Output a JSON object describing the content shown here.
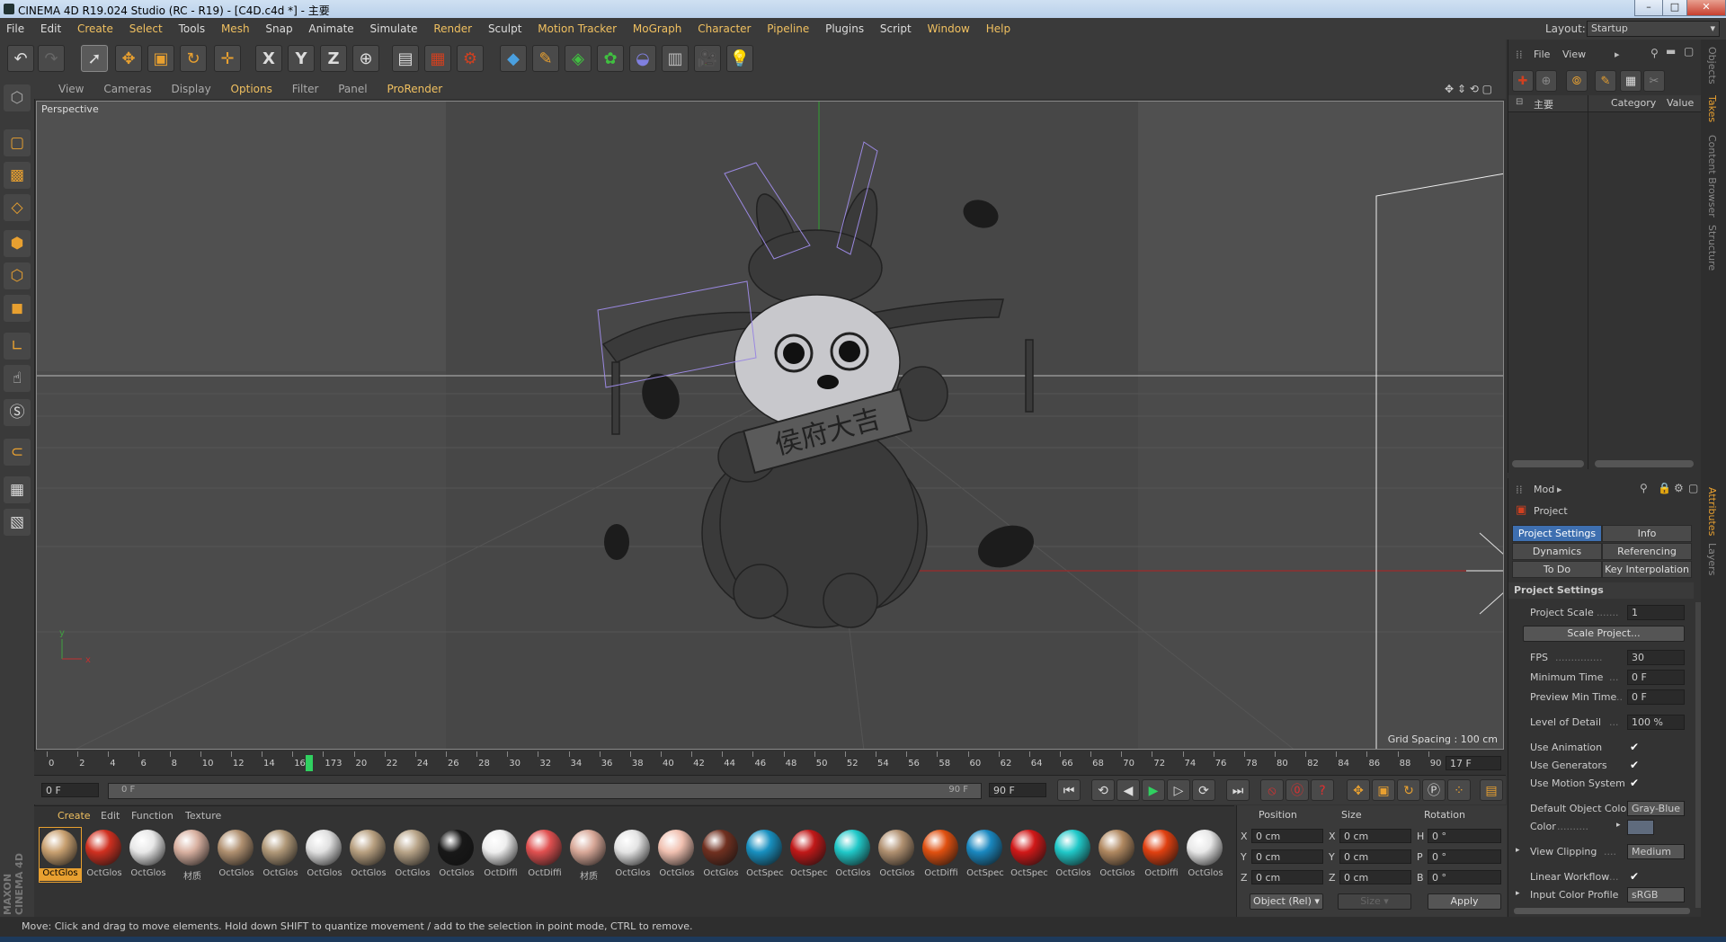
{
  "window": {
    "title": "CINEMA 4D R19.024 Studio (RC - R19) - [C4D.c4d *] - 主要"
  },
  "menubar": {
    "items": [
      "File",
      "Edit",
      "Create",
      "Select",
      "Tools",
      "Mesh",
      "Snap",
      "Animate",
      "Simulate",
      "Render",
      "Sculpt",
      "Motion Tracker",
      "MoGraph",
      "Character",
      "Pipeline",
      "Plugins",
      "Script",
      "Window",
      "Help"
    ]
  },
  "layout": {
    "label": "Layout:",
    "value": "Startup"
  },
  "viewport_menu": {
    "items": [
      "View",
      "Cameras",
      "Display",
      "Options",
      "Filter",
      "Panel",
      "ProRender"
    ]
  },
  "viewport": {
    "name": "Perspective",
    "grid_spacing": "Grid Spacing : 100 cm",
    "axis_y": "y",
    "axis_x": "x",
    "banner_text": "侯府大吉"
  },
  "timeline": {
    "ticks": [
      "0",
      "2",
      "4",
      "6",
      "8",
      "10",
      "12",
      "14",
      "16",
      "173",
      "20",
      "22",
      "24",
      "26",
      "28",
      "30",
      "32",
      "34",
      "36",
      "38",
      "40",
      "42",
      "44",
      "46",
      "48",
      "50",
      "52",
      "54",
      "56",
      "58",
      "60",
      "62",
      "64",
      "66",
      "68",
      "70",
      "72",
      "74",
      "76",
      "78",
      "80",
      "82",
      "84",
      "86",
      "88",
      "90"
    ],
    "current_frame": "17 F",
    "start": "0 F",
    "range_start": "0 F",
    "range_end": "90 F",
    "end": "90 F"
  },
  "material_manager": {
    "menu": [
      "Create",
      "Edit",
      "Function",
      "Texture"
    ],
    "materials": [
      {
        "name": "OctGlos",
        "color": "#c8a070",
        "selected": true
      },
      {
        "name": "OctGlos",
        "color": "#d03020"
      },
      {
        "name": "OctGlos",
        "color": "#e8e8e8"
      },
      {
        "name": "材质",
        "color": "#d8b0a0"
      },
      {
        "name": "OctGlos",
        "color": "#b09070"
      },
      {
        "name": "OctGlos",
        "color": "#b09878"
      },
      {
        "name": "OctGlos",
        "color": "#e0e0e0"
      },
      {
        "name": "OctGlos",
        "color": "#b8a080"
      },
      {
        "name": "OctGlos",
        "color": "#b8a488"
      },
      {
        "name": "OctGlos",
        "color": "#181818"
      },
      {
        "name": "OctDiffi",
        "color": "#eeeeee"
      },
      {
        "name": "OctDiffi",
        "color": "#e05050"
      },
      {
        "name": "材质",
        "color": "#d8a898"
      },
      {
        "name": "OctGlos",
        "color": "#e4e4e4"
      },
      {
        "name": "OctGlos",
        "color": "#f0c0b0"
      },
      {
        "name": "OctGlos",
        "color": "#703020"
      },
      {
        "name": "OctSpec",
        "color": "#1890c0"
      },
      {
        "name": "OctSpec",
        "color": "#c01818"
      },
      {
        "name": "OctGlos",
        "color": "#20c8c8"
      },
      {
        "name": "OctGlos",
        "color": "#b09070"
      },
      {
        "name": "OctDiffi",
        "color": "#e05010"
      },
      {
        "name": "OctSpec",
        "color": "#1a88c0"
      },
      {
        "name": "OctSpec",
        "color": "#d01818"
      },
      {
        "name": "OctGlos",
        "color": "#20c8c8"
      },
      {
        "name": "OctGlos",
        "color": "#b08860"
      },
      {
        "name": "OctDiffi",
        "color": "#e04010"
      },
      {
        "name": "OctGlos",
        "color": "#e8e8e8"
      }
    ]
  },
  "coordinates": {
    "headers": [
      "Position",
      "Size",
      "Rotation"
    ],
    "rows": [
      {
        "axis": "X",
        "pos": "0 cm",
        "size_axis": "X",
        "size": "0 cm",
        "rot_axis": "H",
        "rot": "0 °"
      },
      {
        "axis": "Y",
        "pos": "0 cm",
        "size_axis": "Y",
        "size": "0 cm",
        "rot_axis": "P",
        "rot": "0 °"
      },
      {
        "axis": "Z",
        "pos": "0 cm",
        "size_axis": "Z",
        "size": "0 cm",
        "rot_axis": "B",
        "rot": "0 °"
      }
    ],
    "mode": "Object (Rel)",
    "size_mode": "Size",
    "apply": "Apply"
  },
  "status": "Move: Click and drag to move elements. Hold down SHIFT to quantize movement / add to the selection in point mode, CTRL to remove.",
  "object_manager": {
    "menu": [
      "File",
      "View"
    ],
    "root": "主要",
    "columns": [
      "Category",
      "Value"
    ]
  },
  "attributes": {
    "mode": "Mod",
    "object": "Project",
    "tabs": [
      "Project Settings",
      "Info",
      "Dynamics",
      "Referencing",
      "To Do",
      "Key Interpolation"
    ],
    "section": "Project Settings",
    "fields": {
      "project_scale": {
        "label": "Project Scale",
        "value": "1"
      },
      "scale_project": "Scale Project...",
      "fps": {
        "label": "FPS",
        "value": "30"
      },
      "min_time": {
        "label": "Minimum Time",
        "value": "0 F"
      },
      "preview_min": {
        "label": "Preview Min Time",
        "value": "0 F"
      },
      "lod": {
        "label": "Level of Detail",
        "value": "100 %"
      },
      "use_animation": "Use Animation",
      "use_generators": "Use Generators",
      "use_motion": "Use Motion System",
      "default_color": {
        "label": "Default Object Color",
        "value": "Gray-Blue"
      },
      "color": "Color",
      "view_clipping": {
        "label": "View Clipping",
        "value": "Medium"
      },
      "linear_workflow": "Linear Workflow",
      "input_profile": {
        "label": "Input Color Profile",
        "value": "sRGB"
      }
    }
  },
  "side_tabs": [
    "Objects",
    "Takes",
    "Content Browser",
    "Structure",
    "Attributes",
    "Layers"
  ],
  "brand": "MAXON CINEMA 4D"
}
